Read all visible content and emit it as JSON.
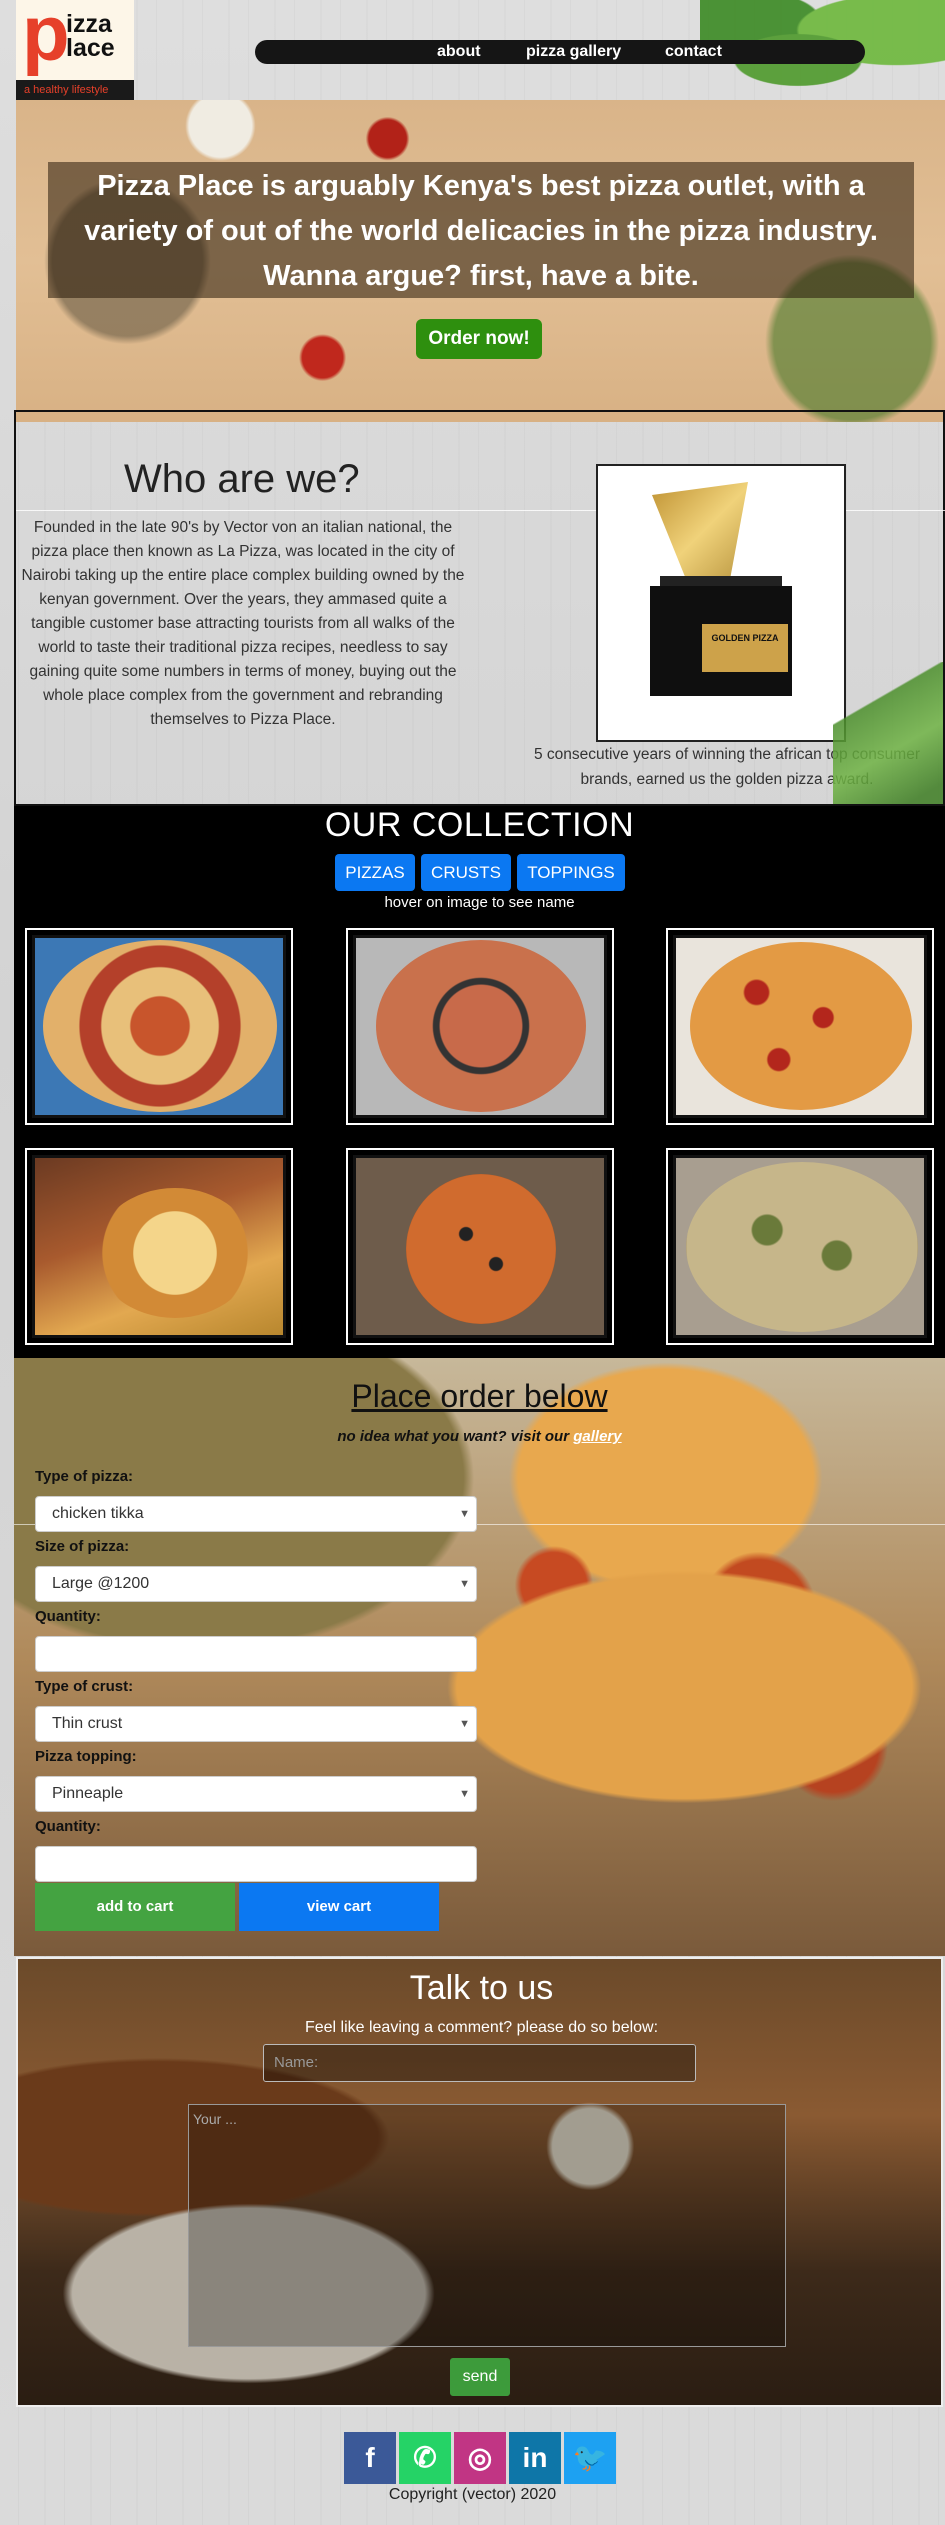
{
  "header": {
    "logo_letter": "p",
    "logo_word1": "izza",
    "logo_word2": "lace",
    "tagline": "a healthy lifestyle",
    "nav": [
      {
        "label": "about"
      },
      {
        "label": "pizza gallery"
      },
      {
        "label": "contact"
      }
    ]
  },
  "hero": {
    "headline": "Pizza Place is arguably Kenya's best pizza outlet, with a variety of out of the world delicacies in the pizza industry. Wanna argue? first, have a bite.",
    "cta": "Order now!"
  },
  "about": {
    "title": "Who are we?",
    "text": "Founded in the late 90's by Vector von an italian national, the pizza place then known as La Pizza, was located in the city of Nairobi taking up the entire place complex building owned by the kenyan government. Over the years, they ammased quite a tangible customer base attracting tourists from all walks of the world to taste their traditional pizza recipes, needless to say gaining quite some numbers in terms of money, buying out the whole place complex from the government and rebranding themselves to Pizza Place.",
    "trophy_plate": "GOLDEN PIZZA",
    "trophy_caption": "5 consecutive years of winning the african top consumer brands, earned us the golden pizza award."
  },
  "collection": {
    "title": "OUR COLLECTION",
    "buttons": [
      "PIZZAS",
      "CRUSTS",
      "TOPPINGS"
    ],
    "hint": "hover on image to see name"
  },
  "order": {
    "title": "Place order below",
    "hint": "no idea what you want? visit our",
    "gallery_link": "gallery",
    "fields": {
      "pizza_type_label": "Type of pizza:",
      "pizza_type_value": "chicken tikka",
      "size_label": "Size of pizza:",
      "size_value": "Large @1200",
      "quantity_label": "Quantity:",
      "crust_label": "Type of crust:",
      "crust_value": "Thin crust",
      "topping_label": "Pizza topping:",
      "topping_value": "Pinneaple",
      "quantity2_label": "Quantity:"
    },
    "add_to_cart": "add to cart",
    "view_cart": "view cart"
  },
  "contact": {
    "title": "Talk to us",
    "subtitle": "Feel like leaving a comment? please do so below:",
    "name_placeholder": "Name:",
    "message_placeholder": "Your ...",
    "send": "send"
  },
  "footer": {
    "social": [
      {
        "icon": "facebook-icon",
        "glyph": "f",
        "color": "#3b5998"
      },
      {
        "icon": "whatsapp-icon",
        "glyph": "✆",
        "color": "#25d366"
      },
      {
        "icon": "instagram-icon",
        "glyph": "◎",
        "color": "#c13584"
      },
      {
        "icon": "linkedin-icon",
        "glyph": "in",
        "color": "#0e76a8"
      },
      {
        "icon": "twitter-icon",
        "glyph": "🐦",
        "color": "#1da1f2"
      }
    ],
    "copyright": "Copyright (vector) 2020"
  },
  "colors": {
    "accent_green": "#2e8f0e",
    "accent_blue": "#0b78f2",
    "logo_red": "#e6402a"
  }
}
